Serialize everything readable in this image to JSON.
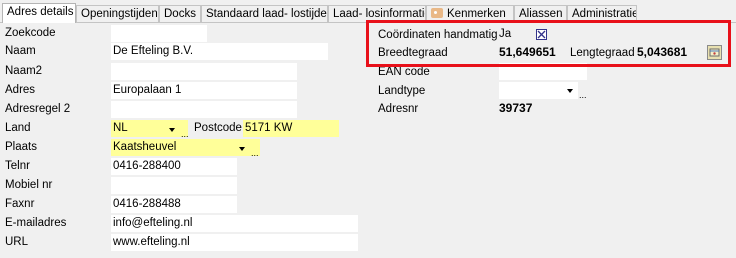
{
  "tabs": [
    {
      "label": "Adres details",
      "active": true
    },
    {
      "label": "Openingstijden"
    },
    {
      "label": "Docks"
    },
    {
      "label": "Standaard laad- lostijden"
    },
    {
      "label": "Laad- losinformatie"
    },
    {
      "label": "Kenmerken",
      "icon": "tag-icon"
    },
    {
      "label": "Aliassen"
    },
    {
      "label": "Administratie"
    }
  ],
  "left": {
    "zoekcode": {
      "label": "Zoekcode",
      "value": ""
    },
    "naam": {
      "label": "Naam",
      "value": "De Efteling B.V."
    },
    "naam2": {
      "label": "Naam2",
      "value": ""
    },
    "adres": {
      "label": "Adres",
      "value": "Europalaan 1"
    },
    "adresregel2": {
      "label": "Adresregel 2",
      "value": ""
    },
    "land": {
      "label": "Land",
      "value": "NL"
    },
    "postcode": {
      "label": "Postcode",
      "value": "5171 KW"
    },
    "plaats": {
      "label": "Plaats",
      "value": "Kaatsheuvel"
    },
    "telnr": {
      "label": "Telnr",
      "value": "0416-288400"
    },
    "mobiel": {
      "label": "Mobiel nr",
      "value": ""
    },
    "faxnr": {
      "label": "Faxnr",
      "value": "0416-288488"
    },
    "email": {
      "label": "E-mailadres",
      "value": "info@efteling.nl"
    },
    "url": {
      "label": "URL",
      "value": "www.efteling.nl"
    }
  },
  "right": {
    "coord_handmatig": {
      "label": "Coördinaten handmatig",
      "value": "Ja",
      "checked": true
    },
    "breedtegraad": {
      "label": "Breedtegraad",
      "value": "51,649651"
    },
    "lengtegraad": {
      "label": "Lengtegraad",
      "value": "5,043681"
    },
    "ean": {
      "label": "EAN code",
      "value": ""
    },
    "landtype": {
      "label": "Landtype",
      "value": ""
    },
    "adresnr": {
      "label": "Adresnr",
      "value": "39737"
    }
  },
  "colors": {
    "highlight": "#e8101a",
    "required_field": "#ffff99",
    "panel": "#f0f0f0"
  }
}
